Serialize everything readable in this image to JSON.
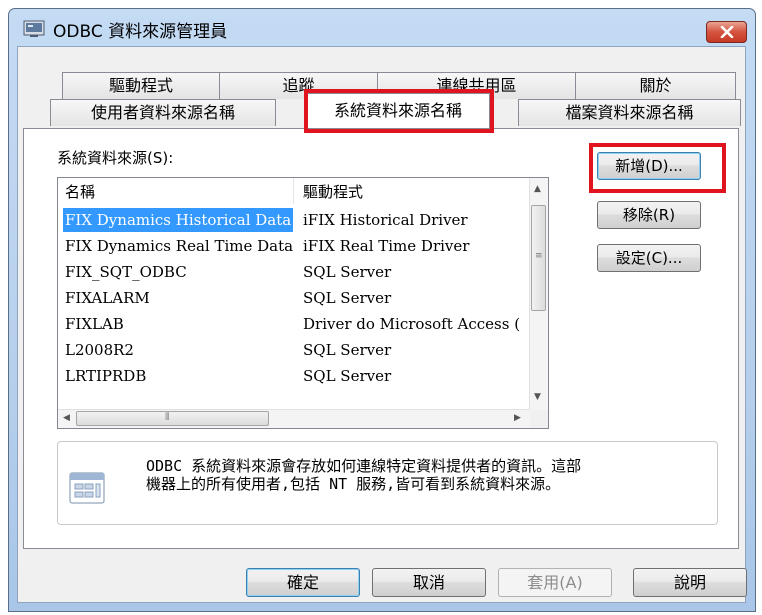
{
  "window": {
    "title": "ODBC 資料來源管理員"
  },
  "tabs": {
    "back": [
      "驅動程式",
      "追蹤",
      "連線共用區",
      "關於"
    ],
    "front": [
      "使用者資料來源名稱",
      "系統資料來源名稱",
      "檔案資料來源名稱"
    ],
    "active": "系統資料來源名稱"
  },
  "panel": {
    "section_label": "系統資料來源(S):",
    "columns": [
      "名稱",
      "驅動程式"
    ],
    "rows": [
      {
        "name": "FIX Dynamics Historical Data",
        "driver": "iFIX Historical Driver",
        "selected": true
      },
      {
        "name": "FIX Dynamics Real Time Data",
        "driver": "iFIX Real Time Driver",
        "selected": false
      },
      {
        "name": "FIX_SQT_ODBC",
        "driver": "SQL Server",
        "selected": false
      },
      {
        "name": "FIXALARM",
        "driver": "SQL Server",
        "selected": false
      },
      {
        "name": "FIXLAB",
        "driver": "Driver do Microsoft Access (",
        "selected": false
      },
      {
        "name": "L2008R2",
        "driver": "SQL Server",
        "selected": false
      },
      {
        "name": "LRTIPRDB",
        "driver": "SQL Server",
        "selected": false
      }
    ],
    "buttons": {
      "add": "新增(D)...",
      "remove": "移除(R)",
      "configure": "設定(C)..."
    },
    "info_text": "ODBC 系統資料來源會存放如何連線特定資料提供者的資訊。這部\n機器上的所有使用者,包括 NT 服務,皆可看到系統資料來源。"
  },
  "footer": {
    "ok": "確定",
    "cancel": "取消",
    "apply": "套用(A)",
    "help": "說明"
  },
  "colors": {
    "highlight_box": "#e0141e",
    "selection": "#3399ff",
    "close_button": "#c53a25"
  },
  "icons": [
    "console-icon",
    "close-icon",
    "info-document-icon"
  ]
}
